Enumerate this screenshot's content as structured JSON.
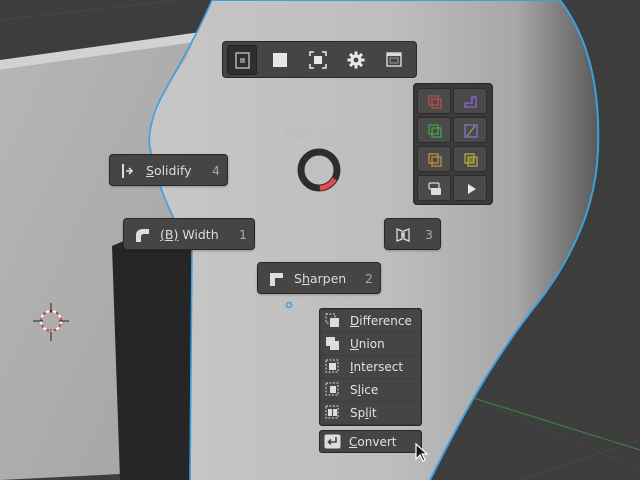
{
  "top_toolbar": {
    "buttons": [
      {
        "icon": "object-mode-icon",
        "active": true
      },
      {
        "icon": "solid-square-icon",
        "active": false
      },
      {
        "icon": "frame-select-icon",
        "active": false
      },
      {
        "icon": "gear-icon",
        "active": false
      },
      {
        "icon": "window-icon",
        "active": false
      }
    ]
  },
  "hops_version": "HOps: 26.1.4",
  "pie_buttons": {
    "solidify": {
      "label_ul": "S",
      "label_rest": "olidify",
      "key": "4"
    },
    "width": {
      "label_ul": "(B)",
      "label_rest": " Width",
      "key": "1"
    },
    "mirror": {
      "key": "3"
    },
    "sharpen": {
      "label_pre": "S",
      "label_ul": "h",
      "label_rest": "arpen",
      "key": "2"
    }
  },
  "operation_menu": [
    {
      "pre": "",
      "ul": "D",
      "rest": "ifference",
      "icon": "difference-icon"
    },
    {
      "pre": "",
      "ul": "U",
      "rest": "nion",
      "icon": "union-icon"
    },
    {
      "pre": "",
      "ul": "I",
      "rest": "ntersect",
      "icon": "intersect-icon"
    },
    {
      "pre": "S",
      "ul": "l",
      "rest": "ice",
      "icon": "slice-icon"
    },
    {
      "pre": "Sp",
      "ul": "l",
      "rest": "it",
      "icon": "split-icon"
    }
  ],
  "convert_button": {
    "ul": "C",
    "rest": "onvert"
  },
  "colors": {
    "selection_outline": "#3d9fe0",
    "progress_red": "#e34a4a",
    "grid_green": "#3e7a44"
  }
}
